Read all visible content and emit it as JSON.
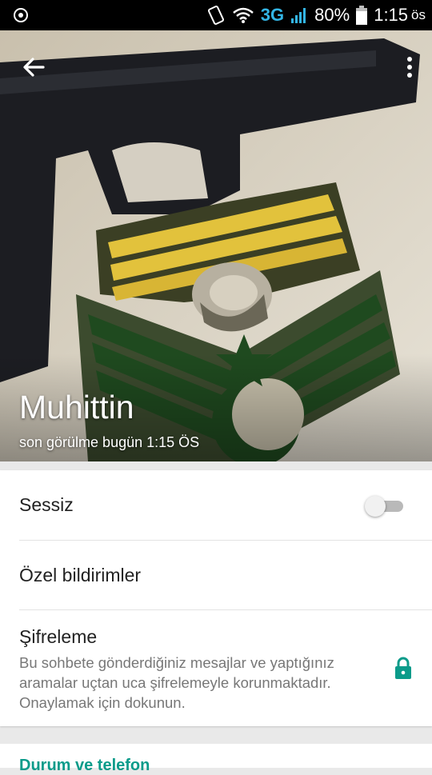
{
  "status_bar": {
    "battery": "80%",
    "network": "3G",
    "time": "1:15",
    "ampm": "ös"
  },
  "header": {
    "contact_name": "Muhittin",
    "last_seen": "son görülme bugün 1:15 ÖS"
  },
  "settings": {
    "mute_label": "Sessiz",
    "mute_on": false,
    "custom_notifications_label": "Özel bildirimler",
    "encryption_label": "Şifreleme",
    "encryption_description": "Bu sohbete gönderdiğiniz mesajlar ve yaptığınız aramalar uçtan uca şifrelemeyle korunmaktadır. Onaylamak için dokunun."
  },
  "section": {
    "status_and_phone": "Durum ve telefon"
  },
  "colors": {
    "accent": "#0b9b8a",
    "status_3g": "#33b5e5"
  }
}
